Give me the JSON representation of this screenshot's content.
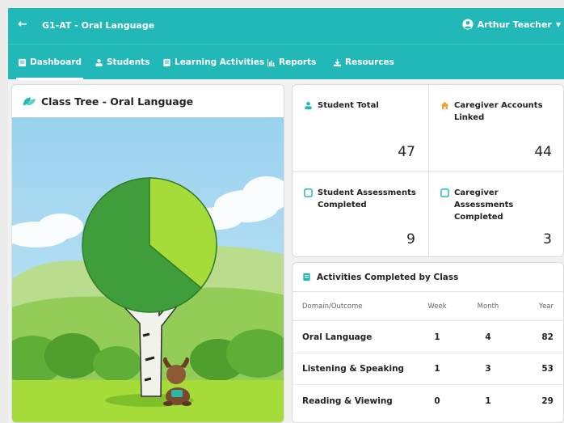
{
  "header": {
    "back_icon": "arrow-left-icon",
    "course_title": "G1-AT - Oral Language",
    "user_name": "Arthur Teacher",
    "user_icon": "user-circle-icon",
    "bar_color": "#23b8b8"
  },
  "nav": {
    "tabs": [
      {
        "label": "Dashboard",
        "icon": "dashboard-icon",
        "active": true
      },
      {
        "label": "Students",
        "icon": "students-icon",
        "active": false
      },
      {
        "label": "Learning Activities",
        "icon": "activities-icon",
        "active": false
      },
      {
        "label": "Reports",
        "icon": "reports-icon",
        "active": false
      },
      {
        "label": "Resources",
        "icon": "resources-icon",
        "active": false
      }
    ]
  },
  "class_tree": {
    "title": "Class Tree - Oral Language",
    "icon": "leaf-icon",
    "progress_fraction": 0.36,
    "filled_color": "#a6dc3a",
    "base_color": "#3f9d3b"
  },
  "stats": [
    {
      "label": "Student Total",
      "value": "47",
      "icon": "student-icon"
    },
    {
      "label": "Caregiver Accounts Linked",
      "value": "44",
      "icon": "home-icon"
    },
    {
      "label": "Student Assessments Completed",
      "value": "9",
      "icon": "checkbox-icon"
    },
    {
      "label": "Caregiver Assessments Completed",
      "value": "3",
      "icon": "checkbox-icon"
    }
  ],
  "activities": {
    "title": "Activities Completed by Class",
    "icon": "book-icon",
    "columns": [
      "Domain/Outcome",
      "Week",
      "Month",
      "Year"
    ],
    "rows": [
      {
        "domain": "Oral Language",
        "week": "1",
        "month": "4",
        "year": "82"
      },
      {
        "domain": "Listening & Speaking",
        "week": "1",
        "month": "3",
        "year": "53"
      },
      {
        "domain": "Reading & Viewing",
        "week": "0",
        "month": "1",
        "year": "29"
      }
    ]
  }
}
